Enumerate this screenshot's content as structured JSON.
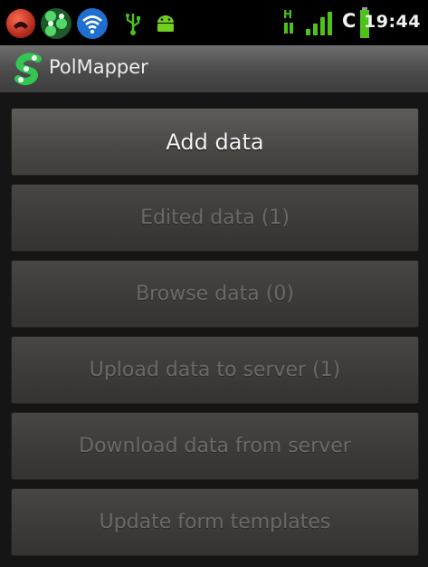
{
  "status_bar": {
    "time": "19:44",
    "carrier_letter": "C",
    "network_label": "H",
    "icons": [
      "phone-icon",
      "polmapper-notification-icon",
      "wifi-icon",
      "usb-icon",
      "android-debug-icon",
      "h-network-icon",
      "signal-bars-icon",
      "battery-icon"
    ],
    "colors": {
      "phone": "#e53a24",
      "wifi": "#2f8fe8",
      "usb": "#4cc21a",
      "android": "#6fd022",
      "signal": "#4cc21a",
      "battery": "#4cc21a"
    }
  },
  "title_bar": {
    "app_name": "PolMapper",
    "app_icon": "polmapper-logo-icon"
  },
  "menu": {
    "items": [
      {
        "label": "Add data",
        "enabled": true
      },
      {
        "label": "Edited data (1)",
        "enabled": false
      },
      {
        "label": "Browse data (0)",
        "enabled": false
      },
      {
        "label": "Upload data to server (1)",
        "enabled": false
      },
      {
        "label": "Download data from server",
        "enabled": false
      },
      {
        "label": "Update form templates",
        "enabled": false
      }
    ]
  },
  "colors": {
    "accent_green": "#35c45a",
    "enabled_text": "#f4f4f4",
    "disabled_text": "#6b6965",
    "background": "#151515"
  }
}
